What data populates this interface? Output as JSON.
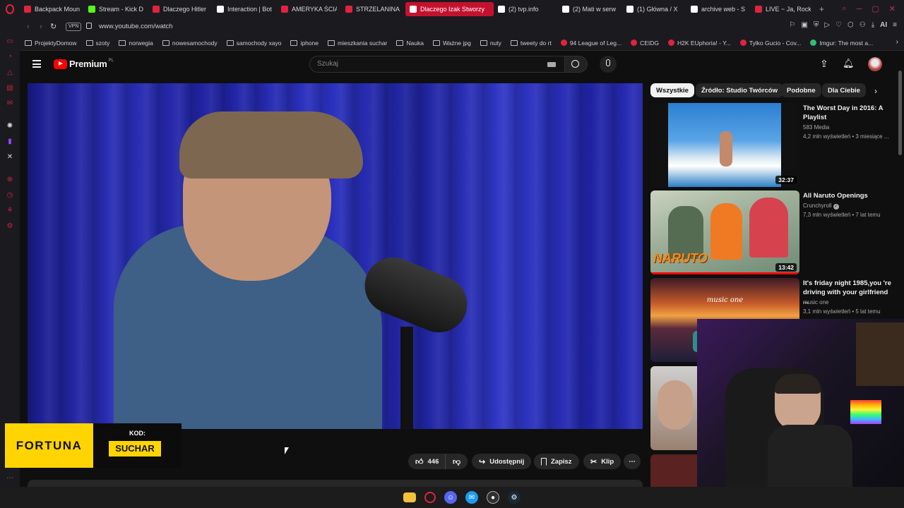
{
  "tabs": [
    {
      "title": "Backpack Mount",
      "color": "#e0233e"
    },
    {
      "title": "Stream - Kick D",
      "color": "#53fc18"
    },
    {
      "title": "Dlaczego Hitler",
      "color": "#e0233e"
    },
    {
      "title": "Interaction | Bot",
      "color": "#ffffff"
    },
    {
      "title": "AMERYKA ŚCIĄ",
      "color": "#e0233e"
    },
    {
      "title": "STRZELANINA W",
      "color": "#e0233e"
    },
    {
      "title": "Dlaczego Izak Stworzy",
      "color": "#ffffff"
    },
    {
      "title": "(2) tvp.info",
      "color": "#ffffff"
    },
    {
      "title": "(2) Mati w serw",
      "color": "#ffffff"
    },
    {
      "title": "(1) Główna / X",
      "color": "#ffffff"
    },
    {
      "title": "archive web - S",
      "color": "#ffffff"
    },
    {
      "title": "LIVE ~ Ja, Rock",
      "color": "#e0233e"
    }
  ],
  "address": {
    "vpn_label": "VPN",
    "url": "www.youtube.com/watch",
    "ai_label": "AI"
  },
  "bookmarks": [
    {
      "label": "ProjektyDomow",
      "kind": "folder"
    },
    {
      "label": "szoty",
      "kind": "folder"
    },
    {
      "label": "norwegia",
      "kind": "folder"
    },
    {
      "label": "nowesamochody",
      "kind": "folder"
    },
    {
      "label": "samochody xayo",
      "kind": "folder"
    },
    {
      "label": "iphone",
      "kind": "folder"
    },
    {
      "label": "mieszkania suchar",
      "kind": "folder"
    },
    {
      "label": "Nauka",
      "kind": "folder"
    },
    {
      "label": "Ważne jpg",
      "kind": "folder"
    },
    {
      "label": "nuty",
      "kind": "folder"
    },
    {
      "label": "tweety do rt",
      "kind": "folder"
    },
    {
      "label": "94 League of Leg...",
      "kind": "site"
    },
    {
      "label": "CEIDG",
      "kind": "site"
    },
    {
      "label": "H2K EUphoria! - Y...",
      "kind": "site"
    },
    {
      "label": "Tylko Gucio - Cov...",
      "kind": "site"
    },
    {
      "label": "Imgur: The most a...",
      "kind": "site"
    }
  ],
  "youtube": {
    "logo_text": "Premium",
    "logo_badge": "PL",
    "search_placeholder": "Szukaj",
    "chips": [
      "Wszystkie",
      "Źródło: Studio Twórców",
      "Podobne",
      "Dla Ciebie"
    ],
    "actions": {
      "likes": "446",
      "share": "Udostępnij",
      "save": "Zapisz",
      "clip": "Klip"
    },
    "recommendations": [
      {
        "title": "The Worst Day in 2016: A Playlist",
        "channel": "583 Media",
        "stats": "4,2 mln wyświetleń • 3 miesiące ...",
        "duration": "32:37"
      },
      {
        "title": "All Naruto Openings",
        "channel": "Crunchyroll",
        "stats": "7,3 mln wyświetleń • 7 lat temu",
        "duration": "13:42"
      },
      {
        "title": "It's friday night 1985,you 're driving with your girlfriend ...",
        "channel": "music one",
        "stats": "3,1 mln wyświetleń • 5 lat temu",
        "duration": ""
      }
    ],
    "thumb_text": {
      "naruto": "NARUTO",
      "music": "music one"
    }
  },
  "overlay": {
    "brand": "FORTUNA",
    "code_label": "KOD:",
    "code_value": "SUCHAR"
  },
  "colors": {
    "accent": "#e0233e",
    "yt_red": "#ff0000",
    "fortuna_yellow": "#ffd400"
  }
}
